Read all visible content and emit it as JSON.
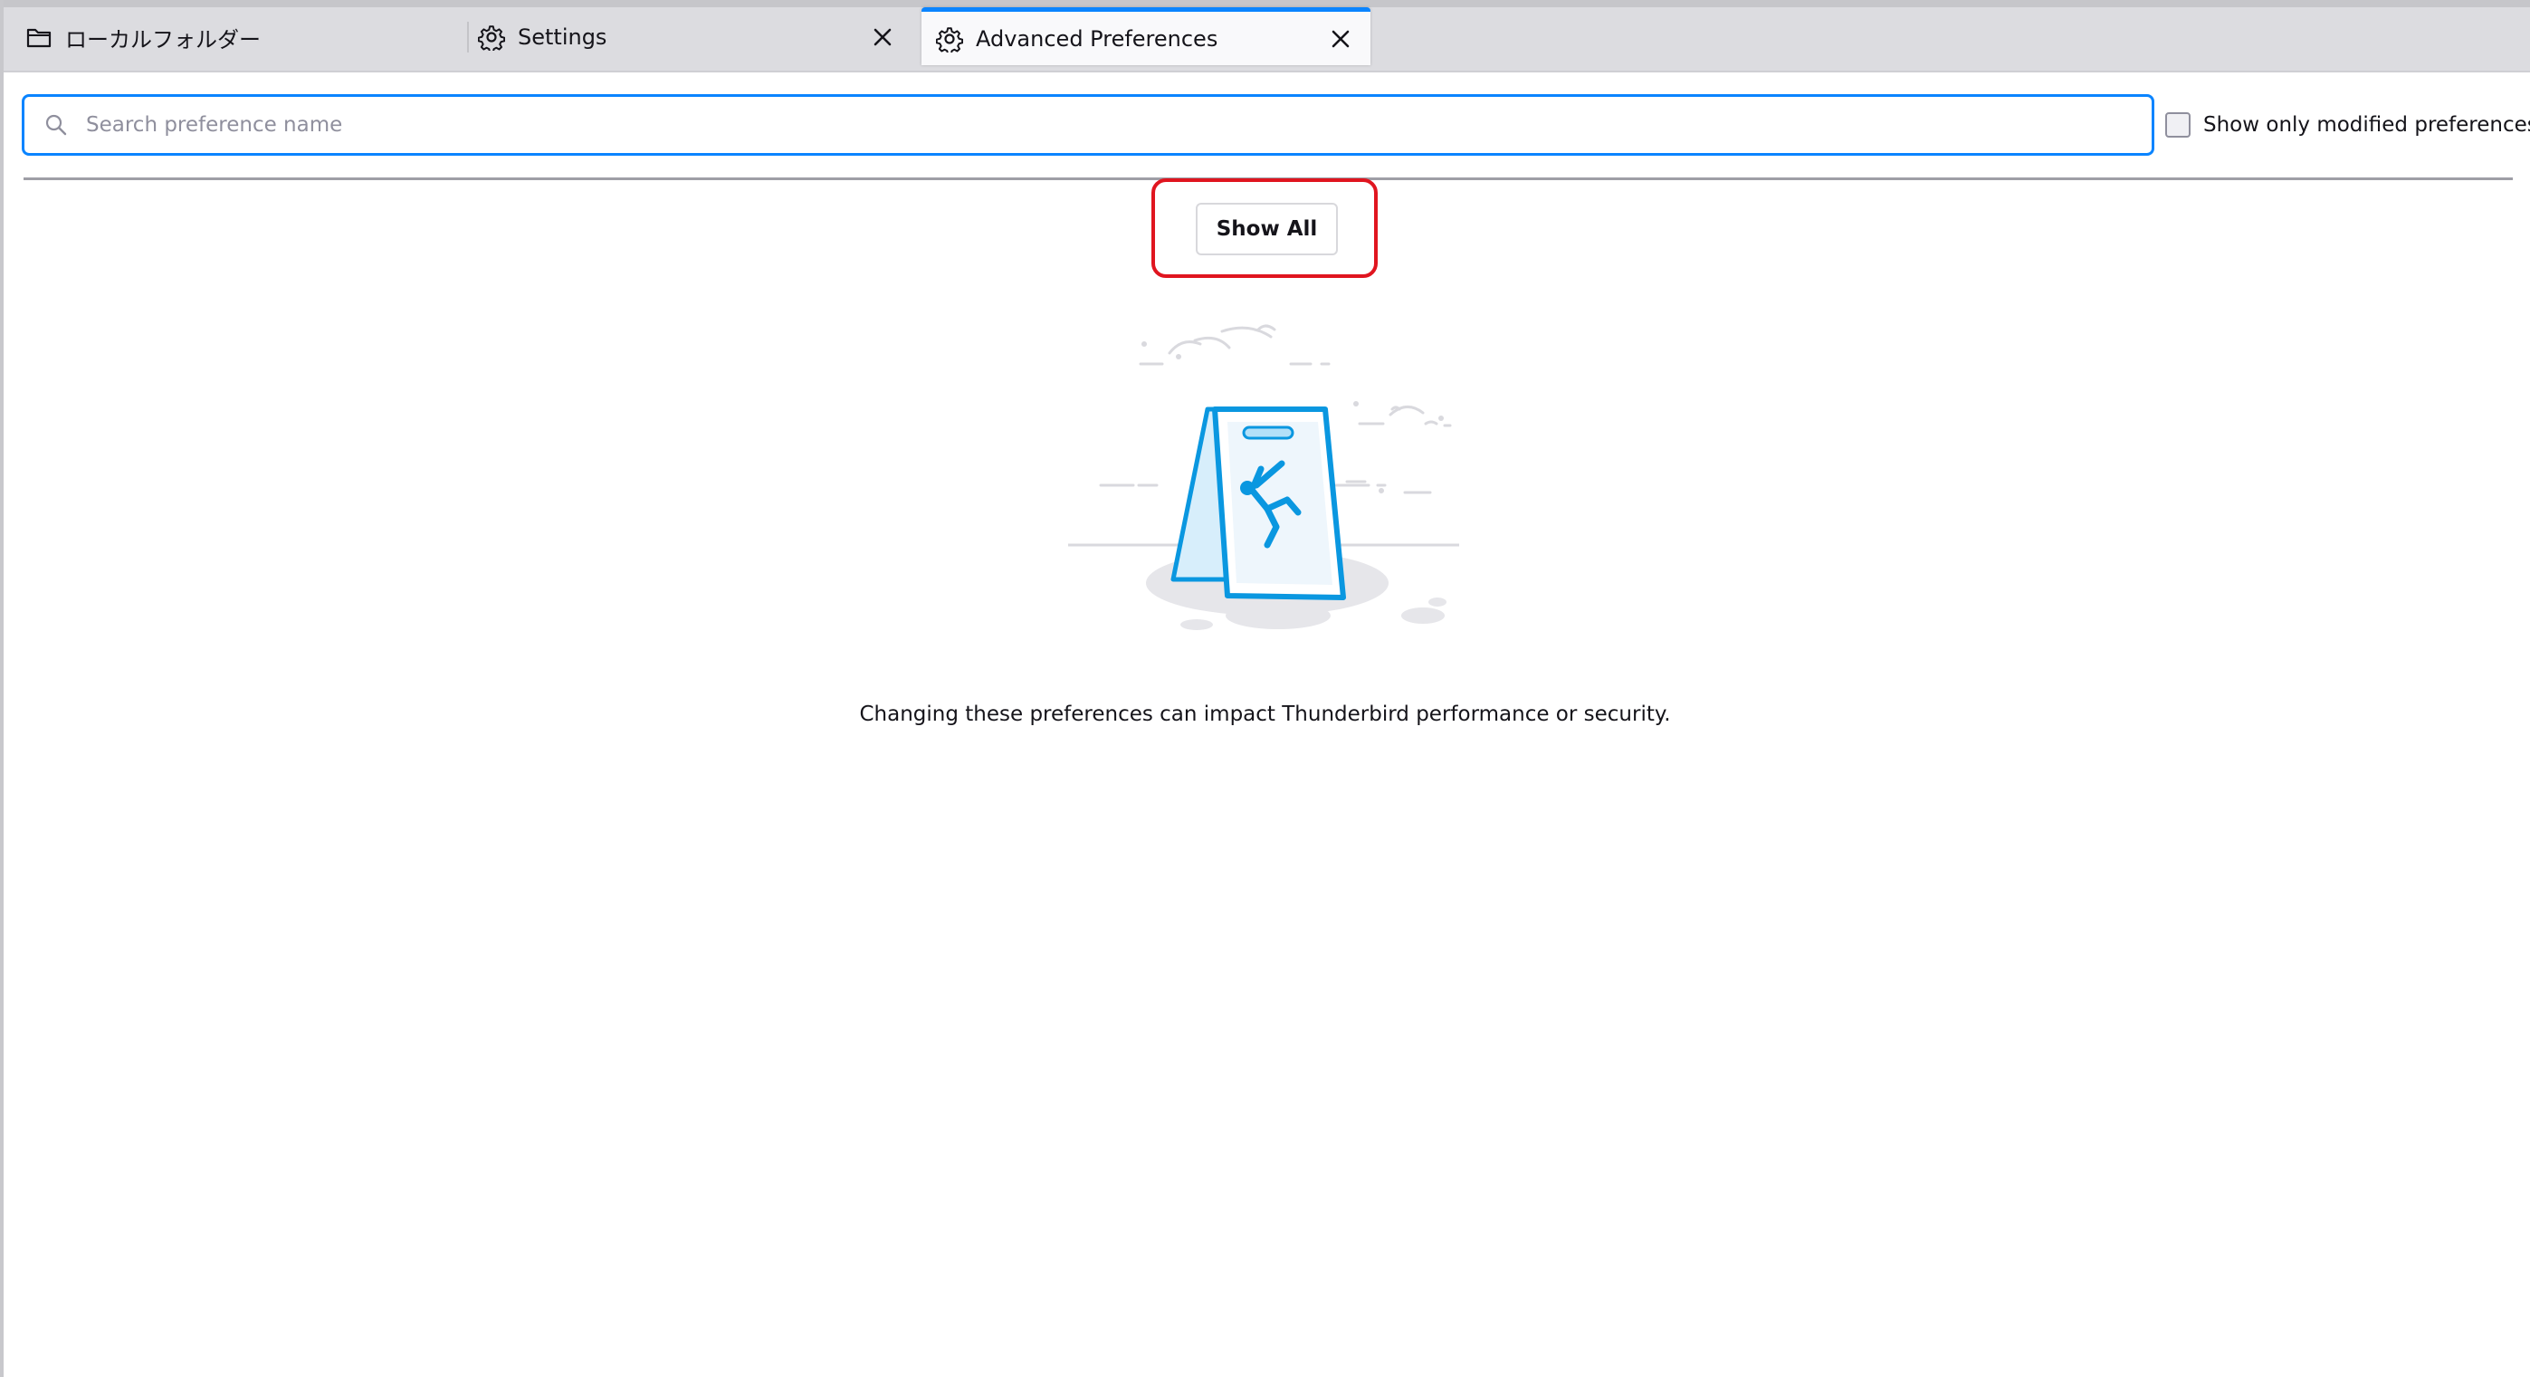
{
  "tabs": [
    {
      "label": "ローカルフォルダー",
      "icon": "folder-icon",
      "active": false,
      "closable": false
    },
    {
      "label": "Settings",
      "icon": "gear-icon",
      "active": false,
      "closable": true
    },
    {
      "label": "Advanced Preferences",
      "icon": "gear-icon",
      "active": true,
      "closable": true
    }
  ],
  "search": {
    "placeholder": "Search preference name",
    "value": ""
  },
  "modified_toggle": {
    "label": "Show only modified preferences",
    "checked": false
  },
  "show_all": {
    "label": "Show All"
  },
  "warning": {
    "text": "Changing these preferences can impact Thunderbird performance or security."
  },
  "colors": {
    "accent": "#0a84ff",
    "highlight": "#e0151f",
    "illustration_blue": "#0a97e0"
  }
}
